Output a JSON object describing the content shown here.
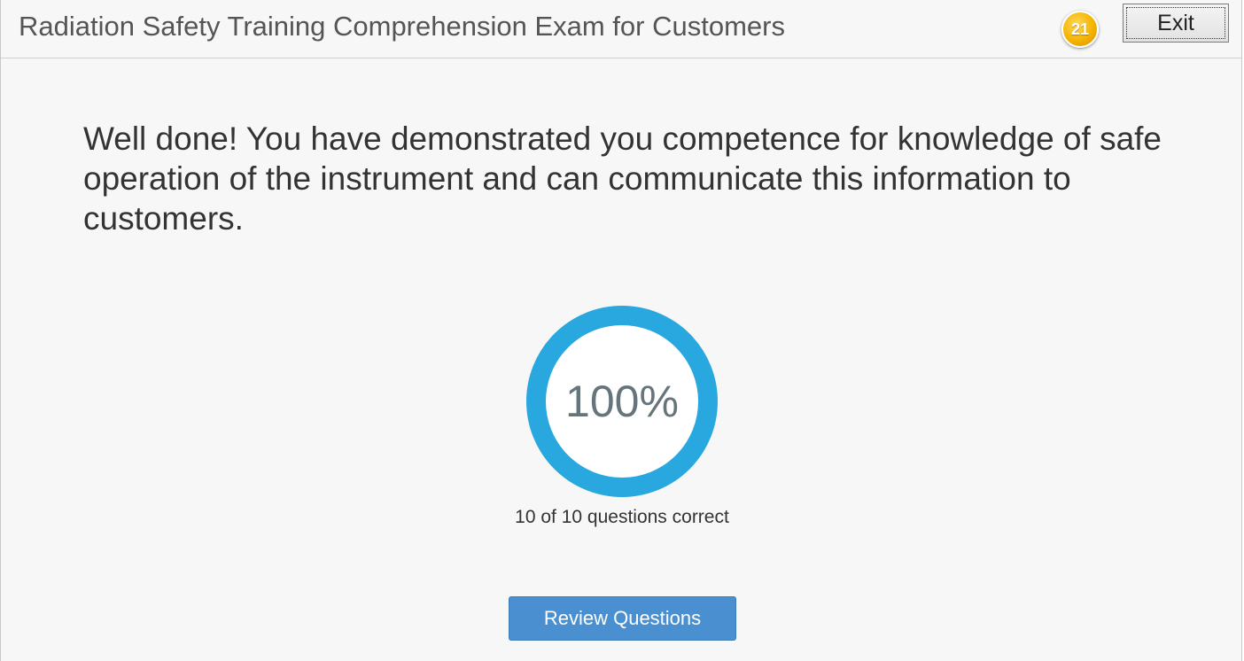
{
  "header": {
    "title": "Radiation Safety Training Comprehension Exam for Customers",
    "badge_number": "21",
    "exit_label": "Exit"
  },
  "result": {
    "message": "Well done! You have demonstrated you competence for knowledge of safe operation of the instrument and can communicate this information to customers.",
    "score_percent_label": "100%",
    "score_fraction": 1.0,
    "summary": "10 of 10 questions correct",
    "review_label": "Review Questions"
  },
  "colors": {
    "ring": "#29a8e0",
    "review_button": "#4a8fd0",
    "badge": "#f4b400"
  },
  "icons": {
    "badge": "numbered-circle-icon"
  }
}
